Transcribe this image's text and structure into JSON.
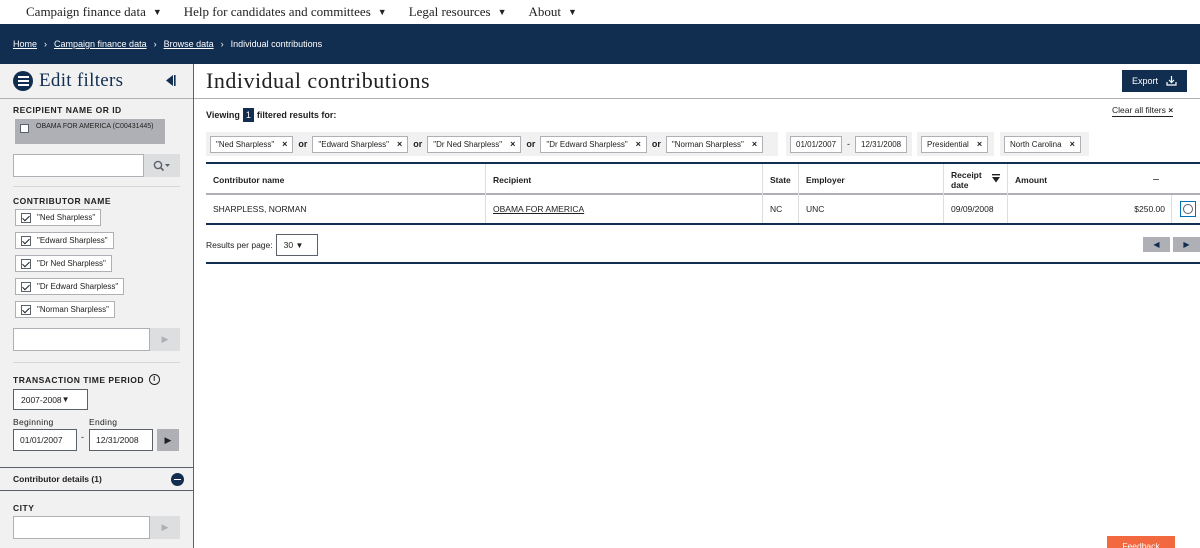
{
  "topnav": {
    "items": [
      {
        "label": "Campaign finance data"
      },
      {
        "label": "Help for candidates and committees"
      },
      {
        "label": "Legal resources"
      },
      {
        "label": "About"
      }
    ],
    "caret": "▼"
  },
  "breadcrumb": {
    "items": [
      "Home",
      "Campaign finance data",
      "Browse data"
    ],
    "current": "Individual contributions",
    "separator": "›"
  },
  "sidebar": {
    "title": "Edit filters",
    "recipient": {
      "label": "RECIPIENT NAME OR ID",
      "chip": "OBAMA FOR AMERICA (C00431445)"
    },
    "contributor": {
      "label": "CONTRIBUTOR NAME",
      "chips": [
        "\"Ned Sharpless\"",
        "\"Edward Sharpless\"",
        "\"Dr Ned Sharpless\"",
        "\"Dr Edward Sharpless\"",
        "\"Norman Sharpless\""
      ]
    },
    "period": {
      "label": "TRANSACTION TIME PERIOD",
      "selected": "2007-2008",
      "beginning_label": "Beginning",
      "ending_label": "Ending",
      "beginning": "01/01/2007",
      "ending": "12/31/2008",
      "dash": "-"
    },
    "details": {
      "label": "Contributor details (1)"
    },
    "city": {
      "label": "CITY"
    }
  },
  "main": {
    "title": "Individual contributions",
    "export_label": "Export",
    "viewing_prefix": "Viewing",
    "count": "1",
    "viewing_suffix": "filtered results for:",
    "clear_all": "Clear all filters",
    "pills": {
      "names": [
        "\"Ned Sharpless\"",
        "\"Edward Sharpless\"",
        "\"Dr Ned Sharpless\"",
        "\"Dr Edward Sharpless\"",
        "\"Norman Sharpless\""
      ],
      "or": "or",
      "date_from": "01/01/2007",
      "date_to": "12/31/2008",
      "date_dash": "-",
      "election": "Presidential",
      "state": "North Carolina",
      "close": "×"
    },
    "table": {
      "headers": [
        "Contributor name",
        "Recipient",
        "State",
        "Employer",
        "Receipt date",
        "Amount"
      ],
      "rows": [
        [
          "SHARPLESS, NORMAN",
          "OBAMA FOR AMERICA",
          "NC",
          "UNC",
          "09/09/2008",
          "$250.00"
        ]
      ]
    },
    "per_page_label": "Results per page:",
    "per_page_value": "30"
  },
  "feedback": "Feedback",
  "colors": {
    "navy": "#112e51",
    "gray_bg": "#f1f1f1",
    "feedback": "#f2693f"
  }
}
